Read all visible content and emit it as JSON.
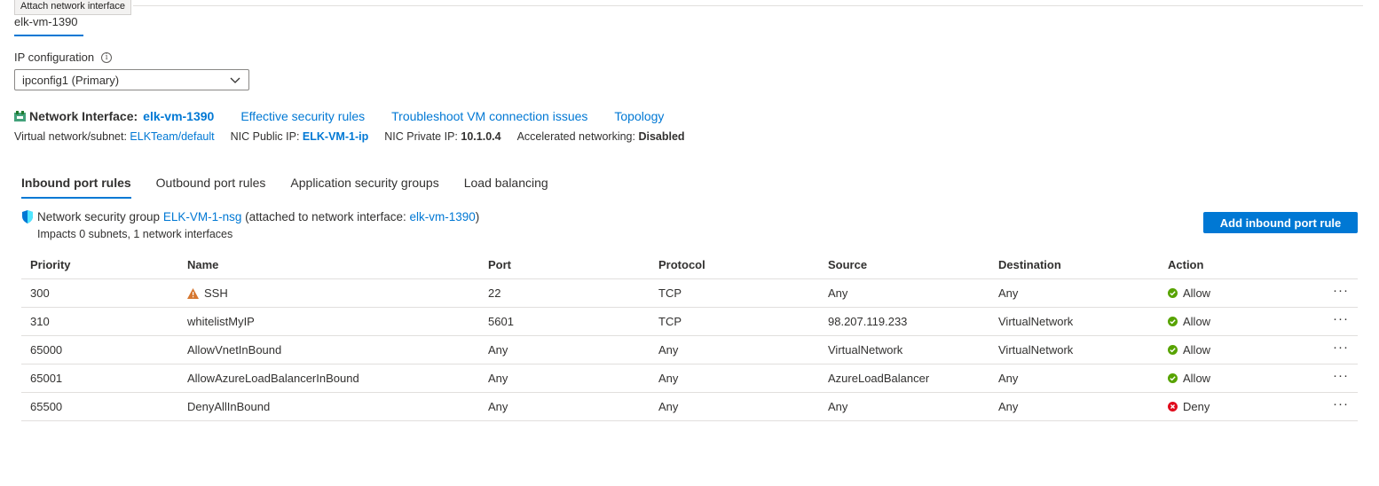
{
  "tooltip": "Attach network interface",
  "nic_tab": "elk-vm-1390",
  "ip_config": {
    "label": "IP configuration",
    "selected": "ipconfig1 (Primary)"
  },
  "network_interface": {
    "label": "Network Interface:",
    "name": "elk-vm-1390",
    "links": [
      "Effective security rules",
      "Troubleshoot VM connection issues",
      "Topology"
    ]
  },
  "meta": {
    "vnet_label": "Virtual network/subnet:",
    "vnet_value": "ELKTeam/default",
    "public_ip_label": "NIC Public IP:",
    "public_ip_value": "ELK-VM-1-ip",
    "private_ip_label": "NIC Private IP:",
    "private_ip_value": "10.1.0.4",
    "accel_label": "Accelerated networking:",
    "accel_value": "Disabled"
  },
  "tabs": [
    "Inbound port rules",
    "Outbound port rules",
    "Application security groups",
    "Load balancing"
  ],
  "nsg": {
    "prefix": "Network security group",
    "name": "ELK-VM-1-nsg",
    "attached_prefix": "(attached to network interface:",
    "attached_nic": "elk-vm-1390",
    "attached_suffix": ")",
    "impacts": "Impacts 0 subnets, 1 network interfaces"
  },
  "add_button": "Add inbound port rule",
  "table": {
    "headers": [
      "Priority",
      "Name",
      "Port",
      "Protocol",
      "Source",
      "Destination",
      "Action"
    ],
    "rows": [
      {
        "priority": "300",
        "name": "SSH",
        "warning": true,
        "port": "22",
        "protocol": "TCP",
        "source": "Any",
        "destination": "Any",
        "action": "Allow"
      },
      {
        "priority": "310",
        "name": "whitelistMyIP",
        "warning": false,
        "port": "5601",
        "protocol": "TCP",
        "source": "98.207.119.233",
        "destination": "VirtualNetwork",
        "action": "Allow"
      },
      {
        "priority": "65000",
        "name": "AllowVnetInBound",
        "warning": false,
        "port": "Any",
        "protocol": "Any",
        "source": "VirtualNetwork",
        "destination": "VirtualNetwork",
        "action": "Allow"
      },
      {
        "priority": "65001",
        "name": "AllowAzureLoadBalancerInBound",
        "warning": false,
        "port": "Any",
        "protocol": "Any",
        "source": "AzureLoadBalancer",
        "destination": "Any",
        "action": "Allow"
      },
      {
        "priority": "65500",
        "name": "DenyAllInBound",
        "warning": false,
        "port": "Any",
        "protocol": "Any",
        "source": "Any",
        "destination": "Any",
        "action": "Deny"
      }
    ],
    "row_menu": "···"
  },
  "colors": {
    "accent": "#0078d4",
    "allow": "#57a300",
    "deny": "#e00b1c",
    "warning": "#d67730"
  }
}
